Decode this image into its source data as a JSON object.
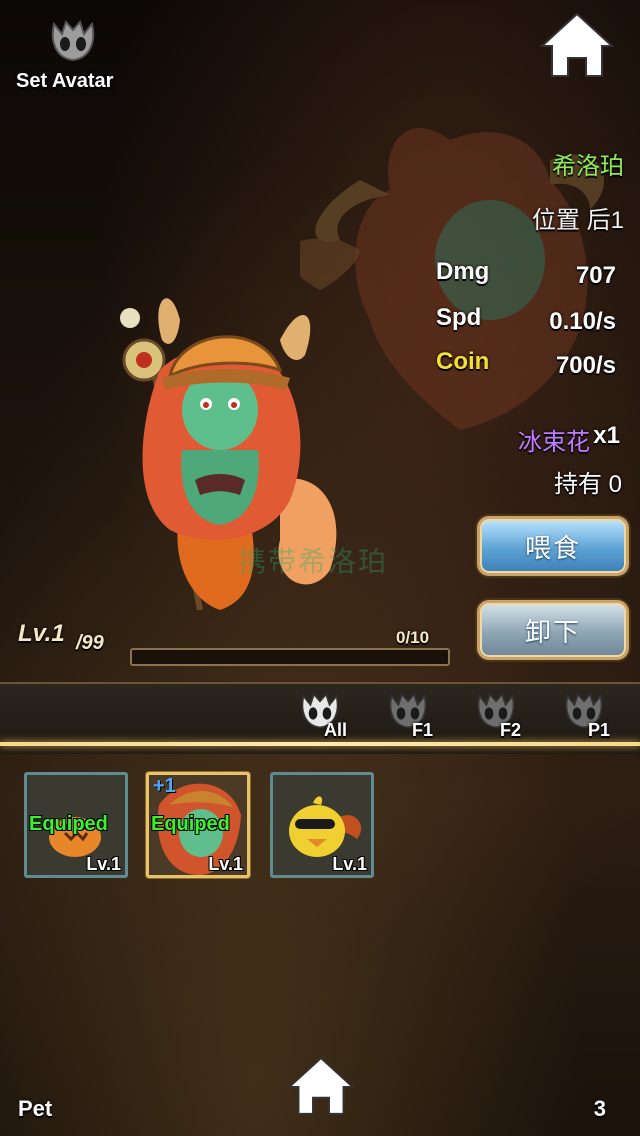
{
  "header": {
    "set_avatar_label": "Set Avatar",
    "avatar_icon": "mask-icon",
    "home_icon": "home-icon"
  },
  "pet": {
    "name": "希洛珀",
    "position": "位置 后1",
    "stats": [
      {
        "label": "Dmg",
        "value": "707",
        "label_color": "#ffffff"
      },
      {
        "label": "Spd",
        "value": "0.10/s",
        "label_color": "#ffffff"
      },
      {
        "label": "Coin",
        "value": "700/s",
        "label_color": "#f2e032"
      }
    ],
    "item_name": "冰束花",
    "item_qty": "x1",
    "owned": "持有 0",
    "watermark": "携带希洛珀"
  },
  "actions": {
    "feed_label": "喂食",
    "remove_label": "卸下"
  },
  "level": {
    "current": "Lv.1",
    "max": "/99",
    "xp_text": "0/10",
    "xp_fraction": 0.0
  },
  "tabs": [
    {
      "label": "All",
      "active": true
    },
    {
      "label": "F1",
      "active": false
    },
    {
      "label": "F2",
      "active": false
    },
    {
      "label": "P1",
      "active": false
    }
  ],
  "pets": [
    {
      "equip_label": "Equiped",
      "level": "Lv.1",
      "plus": "",
      "selected": false,
      "icon": "pumpkin-pet-icon"
    },
    {
      "equip_label": "Equiped",
      "level": "Lv.1",
      "plus": "+1",
      "selected": true,
      "icon": "mermaid-pet-icon"
    },
    {
      "equip_label": "",
      "level": "Lv.1",
      "plus": "",
      "selected": false,
      "icon": "duck-pet-icon"
    }
  ],
  "footer": {
    "section_label": "Pet",
    "count": "3"
  },
  "colors": {
    "name_green": "#8ee85a",
    "item_purple": "#c079ff",
    "equip_green": "#3af22e",
    "accent_gold": "#e8c36a"
  }
}
